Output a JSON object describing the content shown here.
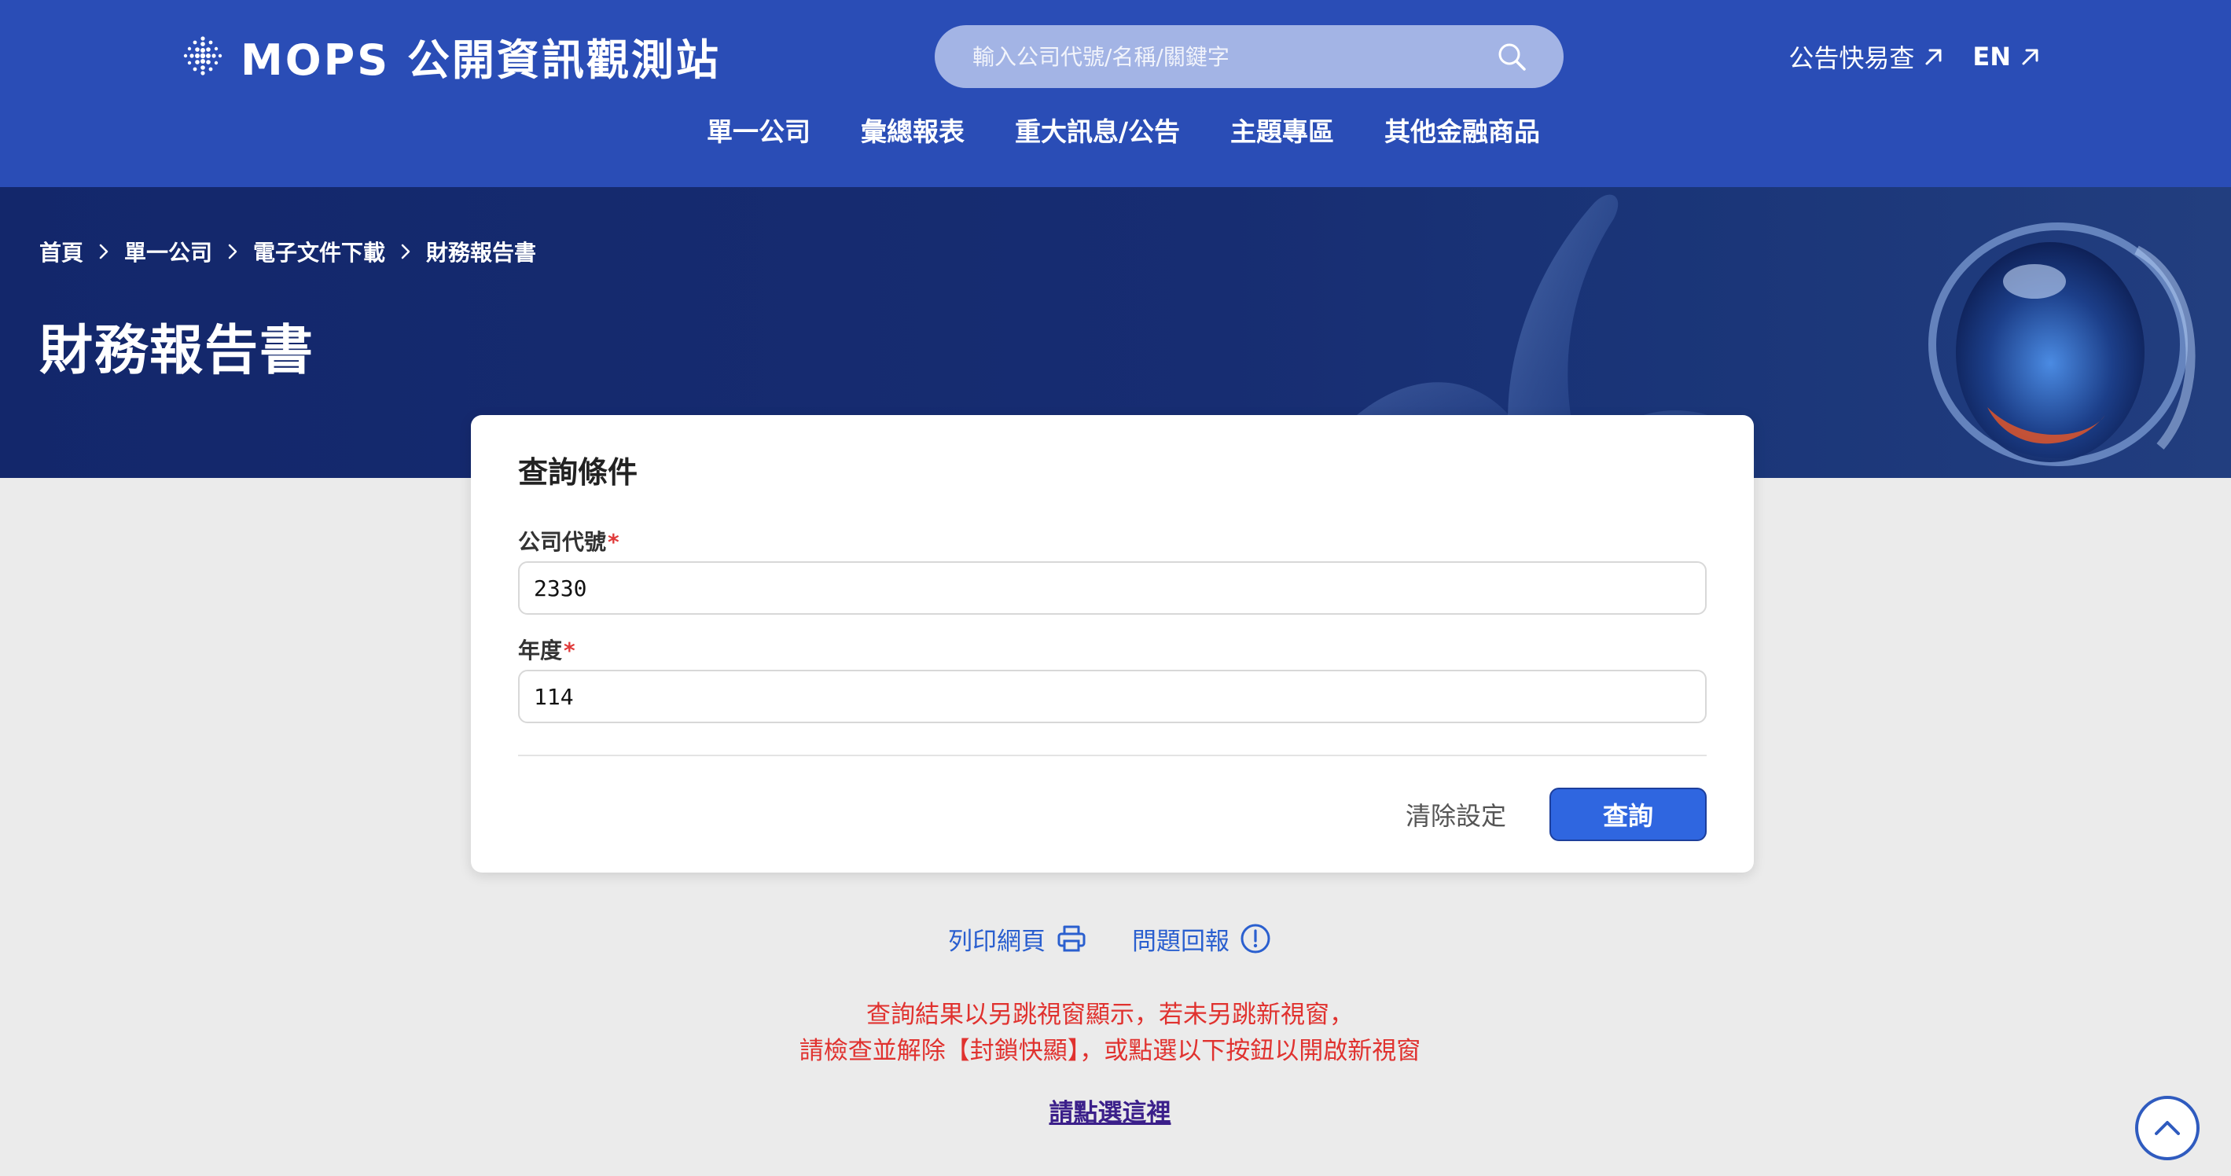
{
  "header": {
    "logo_text": "MOPS 公開資訊觀測站",
    "search_placeholder": "輸入公司代號/名稱/關鍵字",
    "quick_link": "公告快易查",
    "lang_link": "EN",
    "nav": [
      "單一公司",
      "彙總報表",
      "重大訊息/公告",
      "主題專區",
      "其他金融商品"
    ]
  },
  "breadcrumb": [
    "首頁",
    "單一公司",
    "電子文件下載",
    "財務報告書"
  ],
  "page_title": "財務報告書",
  "form": {
    "title": "查詢條件",
    "company_label": "公司代號",
    "company_value": "2330",
    "year_label": "年度",
    "year_value": "114",
    "required_mark": "*",
    "clear_label": "清除設定",
    "query_label": "查詢"
  },
  "actions": {
    "print_label": "列印網頁",
    "report_label": "問題回報"
  },
  "notice": {
    "line1": "查詢結果以另跳視窗顯示，若未另跳新視窗，",
    "line2": "請檢查並解除【封鎖快顯】，或點選以下按鈕以開啟新視窗"
  },
  "click_here": "請點選這裡",
  "colors": {
    "header_bg": "#2a4db6",
    "banner_bg": "#13276b",
    "primary_button": "#2f66e0",
    "link_blue": "#2a5fcf",
    "notice_red": "#e0322f",
    "page_bg": "#ebebeb"
  },
  "icons": [
    "logo-dots-icon",
    "search-icon",
    "arrow-up-right-icon",
    "chevron-right-icon",
    "printer-icon",
    "exclamation-circle-icon",
    "chevron-up-icon"
  ]
}
